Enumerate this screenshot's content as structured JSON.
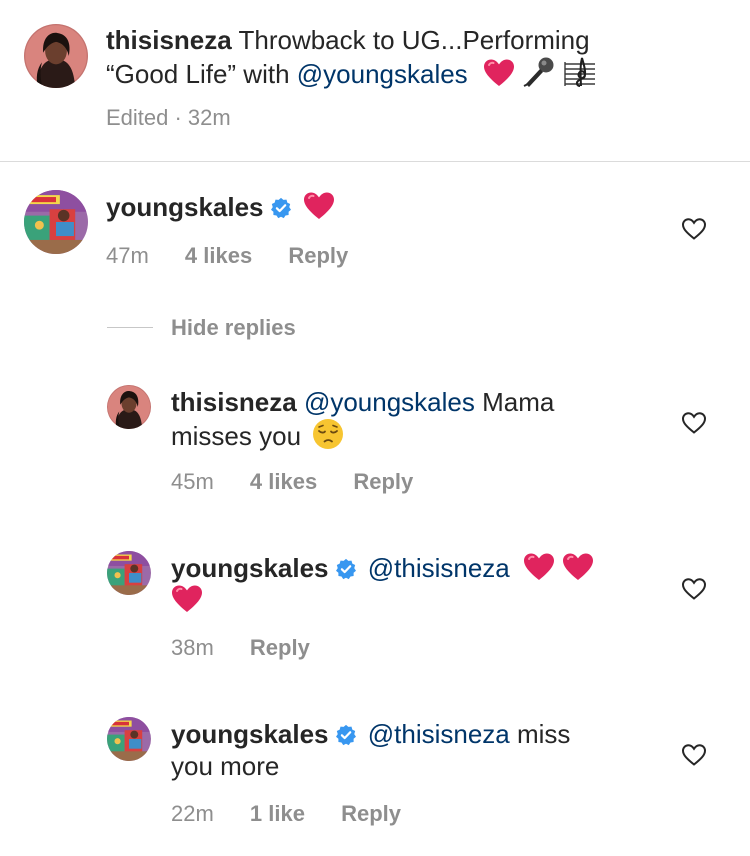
{
  "post": {
    "username": "thisisneza",
    "caption_line1": "Throwback to UG...Performing",
    "caption_line2_before": "“Good Life” with ",
    "caption_mention": "@youngskales",
    "emoji_icons": [
      "red-heart-icon",
      "microphone-icon",
      "musical-score-icon"
    ],
    "meta": "Edited · 32m"
  },
  "comment": {
    "username": "youngskales",
    "verified": true,
    "time": "47m",
    "likes": "4 likes",
    "reply_label": "Reply",
    "hide_replies_label": "Hide replies"
  },
  "replies": [
    {
      "username": "thisisneza",
      "mention": "@youngskales",
      "text_line1": " Mama",
      "text_line2": "misses you",
      "time": "45m",
      "likes": "4 likes",
      "reply_label": "Reply"
    },
    {
      "username": "youngskales",
      "verified": true,
      "mention": "@thisisneza",
      "time": "38m",
      "reply_label": "Reply"
    },
    {
      "username": "youngskales",
      "verified": true,
      "mention": "@thisisneza",
      "text_line1": " miss",
      "text_line2": "you more",
      "time": "22m",
      "likes": "1 like",
      "reply_label": "Reply"
    }
  ],
  "colors": {
    "text": "#262626",
    "mention": "#003569",
    "meta": "#8e8e8e",
    "verified": "#3897f0",
    "heart_emoji": "#e0245e",
    "divider": "#dbdbdb"
  }
}
